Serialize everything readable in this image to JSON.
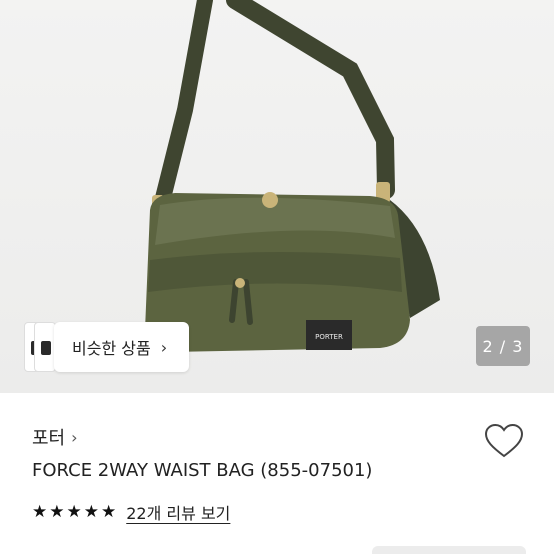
{
  "gallery": {
    "similar_button_label": "비슷한 상품",
    "similar_button_chevron": "›",
    "pager": "2 / 3",
    "image_logo_text": "PORTER"
  },
  "product": {
    "brand": "포터",
    "brand_chevron": "›",
    "name": "FORCE 2WAY WAIST BAG (855-07501)",
    "rating_stars": 5,
    "reviews_label": "22개 리뷰 보기"
  },
  "icons": {
    "wishlist": "heart-outline-icon",
    "star": "star-icon"
  },
  "colors": {
    "bag_olive": "#5c6440",
    "pager_bg": "#a6a6a6"
  }
}
